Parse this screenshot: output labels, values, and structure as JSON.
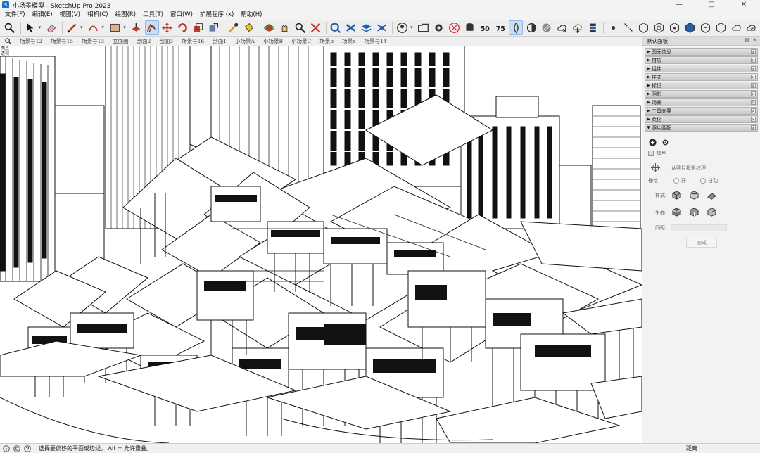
{
  "window": {
    "title": "小场景模型 - SketchUp Pro 2023",
    "minimize": "—",
    "maximize": "▢",
    "close": "✕"
  },
  "menu": [
    "文件(F)",
    "编辑(E)",
    "视图(V)",
    "相机(C)",
    "绘图(R)",
    "工具(T)",
    "窗口(W)",
    "扩展程序 (x)",
    "帮助(H)"
  ],
  "toolbar": {
    "icons": [
      "zoom-icon",
      "select-icon",
      "eraser-icon",
      "pencil-icon",
      "arc-icon",
      "rectangle-icon",
      "push-pull-icon",
      "offset-icon",
      "move-icon",
      "rotate-icon",
      "scale-icon",
      "follow-me-icon",
      "tape-measure-icon",
      "paint-bucket-icon",
      "orbit-icon",
      "pan-icon",
      "zoom-window-icon",
      "zoom-extents-icon",
      "warehouse-icon",
      "extension-icon",
      "layer-icon",
      "section-icon",
      "user-icon",
      "folder-icon",
      "gear-icon",
      "cancel-icon",
      "database-icon",
      "50-icon",
      "75-icon",
      "drop-icon",
      "contrast-icon",
      "hatch-icon",
      "cloud-x-icon",
      "cloud-down-icon",
      "stack-icon",
      "point-icon",
      "dashed-line-icon",
      "hex-1-icon",
      "hex-2-icon",
      "hex-3-icon",
      "hex-4-icon",
      "hex-5-icon",
      "hex-6-icon",
      "cloud-1-icon",
      "cloud-2-icon"
    ]
  },
  "scenes": {
    "tabs": [
      "场景号12",
      "场景号15",
      "场景号13",
      "立面图",
      "剖面2",
      "剖面3",
      "场景号16",
      "剖面1",
      "小场景A",
      "小场景B",
      "小场景C",
      "场景b",
      "场景a",
      "场景号14"
    ]
  },
  "viewport": {
    "label": "两点透视"
  },
  "tray": {
    "title": "默认面板",
    "panels": [
      {
        "label": "图元信息",
        "expanded": false
      },
      {
        "label": "材质",
        "expanded": false
      },
      {
        "label": "组件",
        "expanded": false
      },
      {
        "label": "样式",
        "expanded": false
      },
      {
        "label": "标记",
        "expanded": false
      },
      {
        "label": "阴影",
        "expanded": false
      },
      {
        "label": "场景",
        "expanded": false
      },
      {
        "label": "工具向导",
        "expanded": false
      },
      {
        "label": "柔化",
        "expanded": false
      },
      {
        "label": "照片匹配",
        "expanded": true
      }
    ],
    "match_photo": {
      "model_label": "模型",
      "from_photo_label": "从照片投影纹理",
      "grid_label": "栅格",
      "grid_on": "开",
      "grid_auto": "自动",
      "style_label": "样式:",
      "plane_label": "平面:",
      "spacing_label": "间距:",
      "done_label": "完成"
    }
  },
  "status": {
    "message": "选择要偏移的平面或边线。  Alt = 允许重叠。",
    "measure_label": "距离"
  }
}
